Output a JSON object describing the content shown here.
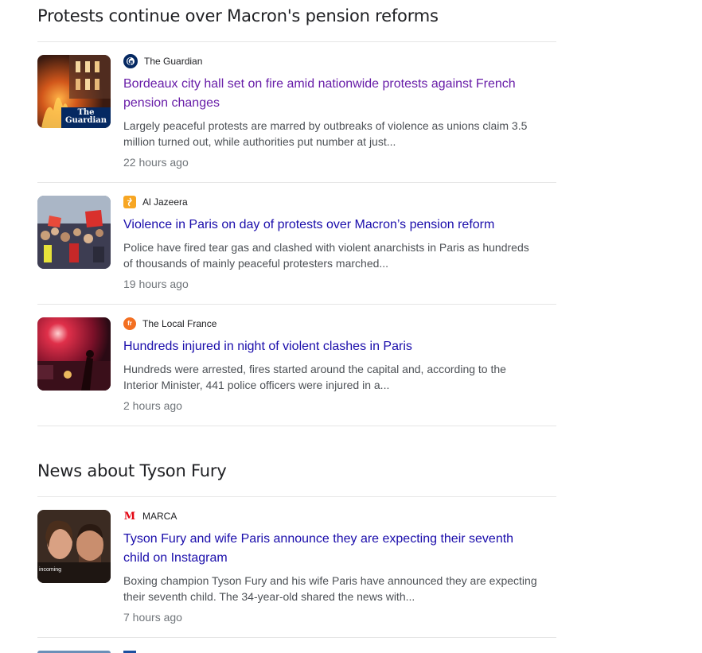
{
  "sections": [
    {
      "title": "Protests continue over Macron's pension reforms",
      "articles": [
        {
          "source": "The Guardian",
          "source_icon": "guardian-logo-icon",
          "thumb_label": "The Guardian",
          "headline": "Bordeaux city hall set on fire amid nationwide protests against French pension changes",
          "snippet": "Largely peaceful protests are marred by outbreaks of violence as unions claim 3.5 million turned out, while authorities put number at just...",
          "time": "22 hours ago"
        },
        {
          "source": "Al Jazeera",
          "source_icon": "aljazeera-logo-icon",
          "headline": "Violence in Paris on day of protests over Macron’s pension reform",
          "snippet": "Police have fired tear gas and clashed with violent anarchists in Paris as hundreds of thousands of mainly peaceful protesters marched...",
          "time": "19 hours ago"
        },
        {
          "source": "The Local France",
          "source_icon": "thelocal-fr-logo-icon",
          "icon_text": "fr",
          "headline": "Hundreds injured in night of violent clashes in Paris",
          "snippet": "Hundreds were arrested, fires started around the capital and, according to the Interior Minister, 441 police officers were injured in a...",
          "time": "2 hours ago"
        }
      ]
    },
    {
      "title": "News about Tyson Fury",
      "articles": [
        {
          "source": "MARCA",
          "source_icon": "marca-logo-icon",
          "icon_text": "M",
          "thumb_label": "incoming",
          "headline": "Tyson Fury and wife Paris announce they are expecting their seventh child on Instagram",
          "snippet": "Boxing champion Tyson Fury and his wife Paris have announced they are expecting their seventh child. The 34-year-old shared the news with...",
          "time": "7 hours ago"
        }
      ]
    }
  ],
  "colors": {
    "link": "#1a0dab",
    "visited_link": "#681da8",
    "snippet": "#4d5156",
    "time": "#70757a",
    "divider": "#e6e6e6"
  }
}
